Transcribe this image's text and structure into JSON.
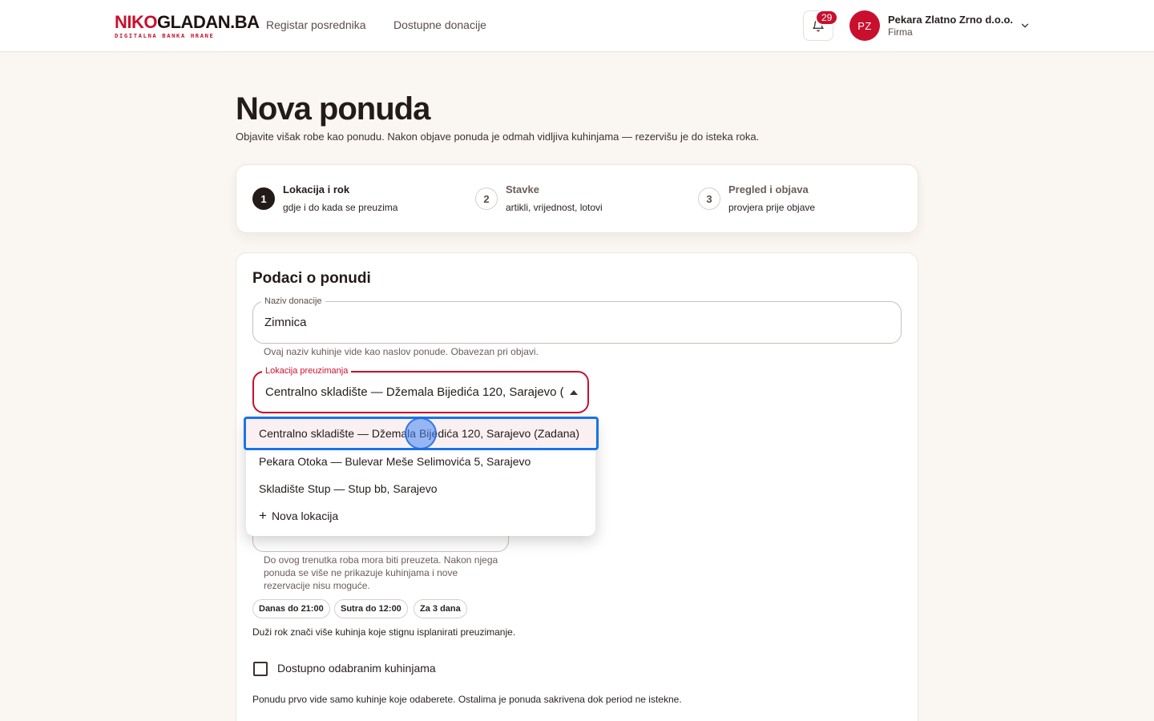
{
  "header": {
    "logo_part1": "NIKO",
    "logo_part2": "GLADAN.BA",
    "logo_sub": "DIGITALNA BANKA HRANE",
    "nav": [
      "Registar posrednika",
      "Dostupne donacije"
    ],
    "notification_count": "29",
    "user": {
      "initials": "PZ",
      "name": "Pekara Zlatno Zrno d.o.o.",
      "role": "Firma"
    }
  },
  "page": {
    "title": "Nova ponuda",
    "subtitle": "Objavite višak robe kao ponudu. Nakon objave ponuda je odmah vidljiva kuhinjama — rezervišu je do isteka roka."
  },
  "stepper": [
    {
      "num": "1",
      "title": "Lokacija i rok",
      "desc": "gdje i do kada se preuzima",
      "active": true
    },
    {
      "num": "2",
      "title": "Stavke",
      "desc": "artikli, vrijednost, lotovi",
      "active": false
    },
    {
      "num": "3",
      "title": "Pregled i objava",
      "desc": "provjera prije objave",
      "active": false
    }
  ],
  "form": {
    "title": "Podaci o ponudi",
    "name_field": {
      "label": "Naziv donacije",
      "value": "Zimnica",
      "helper": "Ovaj naziv kuhinje vide kao naslov ponude. Obavezan pri objavi."
    },
    "location_field": {
      "label": "Lokacija preuzimanja",
      "value": "Centralno skladište — Džemala Bijedića 120, Sarajevo (Z..."
    },
    "deadline_helper": "Do ovog trenutka roba mora biti preuzeta. Nakon njega ponuda se više ne prikazuje kuhinjama i nove rezervacije nisu moguće.",
    "chips": [
      "Danas do 21:00",
      "Sutra do 12:00",
      "Za 3 dana"
    ],
    "chips_note": "Duži rok znači više kuhinja koje stignu isplanirati preuzimanje.",
    "checkbox_label": "Dostupno odabranim kuhinjama",
    "checkbox_note": "Ponudu prvo vide samo kuhinje koje odaberete. Ostalima je ponuda sakrivena dok period ne istekne."
  },
  "dropdown": {
    "options": [
      "Centralno skladište — Džemala Bijedića 120, Sarajevo (Zadana)",
      "Pekara Otoka — Bulevar Meše Selimovića 5, Sarajevo",
      "Skladište Stup — Stup bb, Sarajevo"
    ],
    "add_new": "Nova lokacija",
    "add_new_icon": "+"
  }
}
